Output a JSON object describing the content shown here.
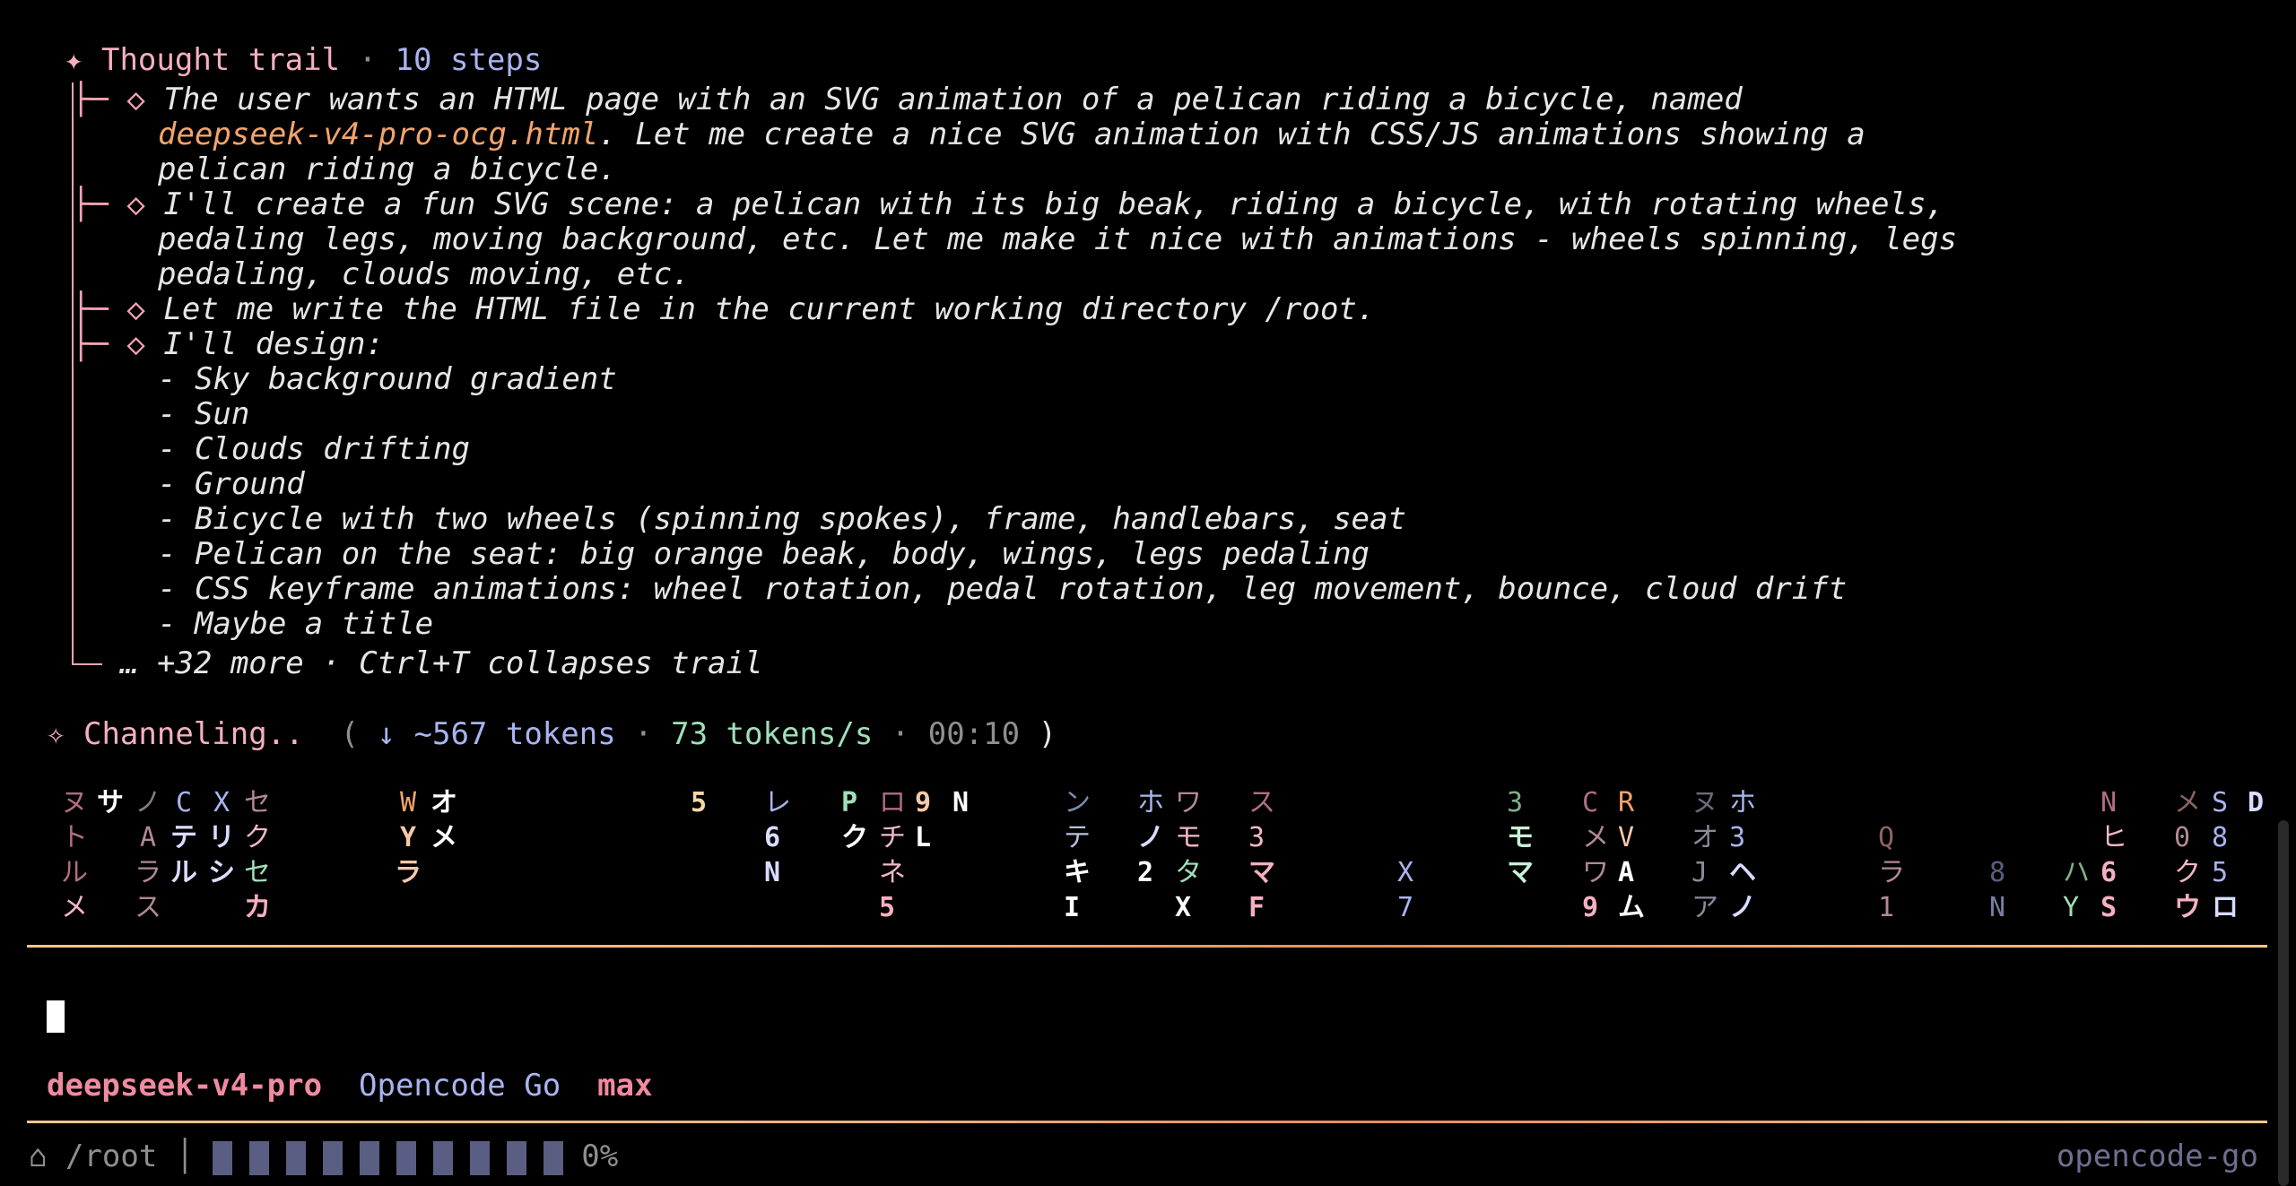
{
  "trail": {
    "icon": "✦",
    "title": "Thought trail",
    "sep": "·",
    "steps": "10 steps",
    "items": [
      {
        "lines": [
          [
            "The user wants an HTML page with an SVG animation of a pelican riding a bicycle, named"
          ],
          [
            "deepseek-v4-pro-ocg.html",
            ". Let me create a nice SVG animation with CSS/JS animations showing a"
          ],
          [
            "pelican riding a bicycle."
          ]
        ]
      },
      {
        "lines": [
          [
            "I'll create a fun SVG scene: a pelican with its big beak, riding a bicycle, with rotating wheels,"
          ],
          [
            "pedaling legs, moving background, etc. Let me make it nice with animations - wheels spinning, legs"
          ],
          [
            "pedaling, clouds moving, etc."
          ]
        ]
      },
      {
        "lines": [
          [
            "Let me write the HTML file in the current working directory /root."
          ]
        ]
      },
      {
        "lines": [
          [
            "I'll design:"
          ],
          [
            "- Sky background gradient"
          ],
          [
            "- Sun"
          ],
          [
            "- Clouds drifting"
          ],
          [
            "- Ground"
          ],
          [
            "- Bicycle with two wheels (spinning spokes), frame, handlebars, seat"
          ],
          [
            "- Pelican on the seat: big orange beak, body, wings, legs pedaling"
          ],
          [
            "- CSS keyframe animations: wheel rotation, pedal rotation, leg movement, bounce, cloud drift"
          ],
          [
            "- Maybe a title"
          ]
        ]
      }
    ],
    "more": "… +32 more · Ctrl+T collapses trail"
  },
  "status": {
    "icon": "✧",
    "label": "Channeling..",
    "open": "(",
    "arrow": "↓",
    "tokens": "~567 tokens",
    "dot1": "·",
    "rate": "73 tokens/s",
    "dot2": "·",
    "time": "00:10",
    "close": ")"
  },
  "rain": [
    [
      "ヌ",
      "ト",
      "ル",
      "メ"
    ],
    [
      "サ",
      "",
      "",
      ""
    ],
    [
      "ノ",
      "A",
      "ラ",
      "ス"
    ],
    [
      "C",
      "テ",
      "ル",
      ""
    ],
    [
      "X",
      "リ",
      "シ",
      ""
    ],
    [
      "セ",
      "ク",
      "セ",
      "カ"
    ]
  ],
  "rain2": [
    [
      "W",
      "Y",
      "ラ",
      ""
    ],
    [
      "オ",
      "メ",
      "",
      ""
    ]
  ],
  "prompt": {
    "value": ""
  },
  "model": {
    "name": "deepseek-v4-pro",
    "provider": "Opencode Go",
    "variant": "max"
  },
  "footer": {
    "home_icon": "⌂",
    "path": "/root",
    "divider": "│",
    "percent": "0%",
    "brand": "opencode-go"
  },
  "colors": {
    "accent_pink": "#f5b0bf",
    "lavender": "#a9b4f0",
    "orange": "#f2a46c",
    "green": "#9fe0b8",
    "divider": "#f3b07d"
  }
}
